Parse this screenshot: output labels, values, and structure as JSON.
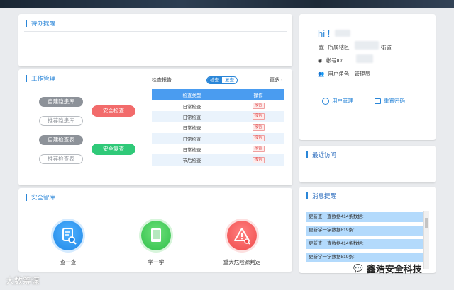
{
  "pending": {
    "title": "待办提醒"
  },
  "work": {
    "title": "工作管理",
    "buttons": {
      "hazard_library": "自建隐患库",
      "recommended_hazard": "推荐隐患库",
      "check_table": "自建检查表",
      "recommended_table": "推荐检查表",
      "safety_check": "安全检查",
      "safety_recheck": "安全复查"
    },
    "report_label": "检查报告",
    "toggle": [
      "检查",
      "复查"
    ],
    "more": "更多 ›",
    "table": {
      "headers": [
        "检查类型",
        "操作"
      ],
      "rows": [
        [
          "日常检查",
          "报告"
        ],
        [
          "日常检查",
          "报告"
        ],
        [
          "日常检查",
          "报告"
        ],
        [
          "日常检查",
          "报告"
        ],
        [
          "日常检查",
          "报告"
        ],
        [
          "节后检查",
          "报告"
        ]
      ]
    }
  },
  "library": {
    "title": "安全智库",
    "items": [
      {
        "label": "查一查",
        "icon": "search-document-icon",
        "color": "#1f87e6"
      },
      {
        "label": "学一学",
        "icon": "book-icon",
        "color": "#2fbf48"
      },
      {
        "label": "重大危险源判定",
        "icon": "warning-search-icon",
        "color": "#ef4a4a"
      }
    ]
  },
  "user": {
    "greeting": "hi !",
    "district_label": "所属辖区:",
    "district_suffix": "街道",
    "account_label": "帐号ID:",
    "role_label": "用户角色:",
    "role_value": "管理员",
    "manage_label": "用户管理",
    "reset_label": "重置密码"
  },
  "recent": {
    "title": "最近访问"
  },
  "messages": {
    "title": "消息提醒",
    "items": [
      "更新查一查数据414条数据:",
      "更新学一学数据819条:",
      "更新查一查数据414条数据:",
      "更新学一学数据819条:"
    ]
  },
  "watermark": "大数筹谋",
  "brand": "鑫浩安全科技",
  "colors": {
    "accent": "#2a86d8",
    "danger": "#f26b6b",
    "success": "#2fc978"
  }
}
